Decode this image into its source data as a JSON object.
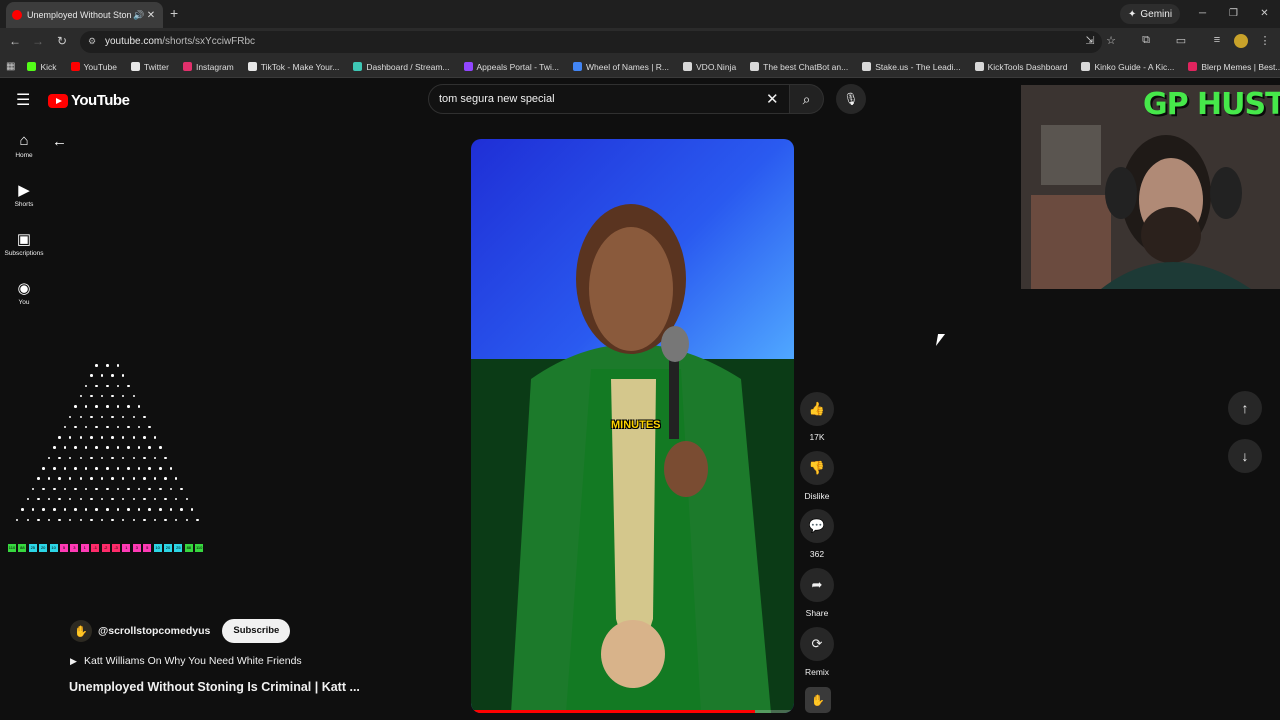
{
  "browser": {
    "tab_title": "Unemployed Without Stoni",
    "url_host": "youtube.com",
    "url_path": "/shorts/sxYcciwFRbc",
    "gemini_label": "Gemini",
    "bookmarks": [
      {
        "label": "Kick",
        "color": "#53fc18"
      },
      {
        "label": "YouTube",
        "color": "#ff0000"
      },
      {
        "label": "Twitter",
        "color": "#e7e7e7"
      },
      {
        "label": "Instagram",
        "color": "#e1306c"
      },
      {
        "label": "TikTok - Make Your...",
        "color": "#e7e7e7"
      },
      {
        "label": "Dashboard / Stream...",
        "color": "#3ec7b5"
      },
      {
        "label": "Appeals Portal - Twi...",
        "color": "#9146ff"
      },
      {
        "label": "Wheel of Names | R...",
        "color": "#4285f4"
      },
      {
        "label": "VDO.Ninja",
        "color": "#d8d8d8"
      },
      {
        "label": "The best ChatBot an...",
        "color": "#d8d8d8"
      },
      {
        "label": "Stake.us - The Leadi...",
        "color": "#d8d8d8"
      },
      {
        "label": "KickTools Dashboard",
        "color": "#d8d8d8"
      },
      {
        "label": "Kinko Guide - A Kic...",
        "color": "#d8d8d8"
      },
      {
        "label": "Blerp Memes | Best...",
        "color": "#e0245e"
      }
    ]
  },
  "youtube": {
    "logo": "YouTube",
    "search_value": "tom segura new special",
    "guide": [
      {
        "label": "Home",
        "icon": "home-icon",
        "glyph": "⌂"
      },
      {
        "label": "Shorts",
        "icon": "shorts-icon",
        "glyph": "▶"
      },
      {
        "label": "Subscriptions",
        "icon": "subscriptions-icon",
        "glyph": "▣"
      },
      {
        "label": "You",
        "icon": "you-icon",
        "glyph": "◉"
      }
    ]
  },
  "short": {
    "caption": "MINUTES",
    "progress_fraction": 0.88,
    "actions": {
      "like_count": "17K",
      "dislike_label": "Dislike",
      "comment_count": "362",
      "share_label": "Share",
      "remix_label": "Remix"
    },
    "channel_handle": "@scrollstopcomedyus",
    "subscribe_label": "Subscribe",
    "related_title": "Katt Williams On Why You Need White Friends",
    "title": "Unemployed Without Stoning Is Criminal | Katt ..."
  },
  "overlays": {
    "webcam_title": "GP HUSTLA",
    "plinko_slots": [
      "110",
      "88",
      "25",
      "20",
      "10",
      "5",
      "3",
      "1",
      "-1",
      "-2",
      "-3",
      "1",
      "3",
      "5",
      "10",
      "20",
      "25",
      "88",
      "110"
    ]
  }
}
